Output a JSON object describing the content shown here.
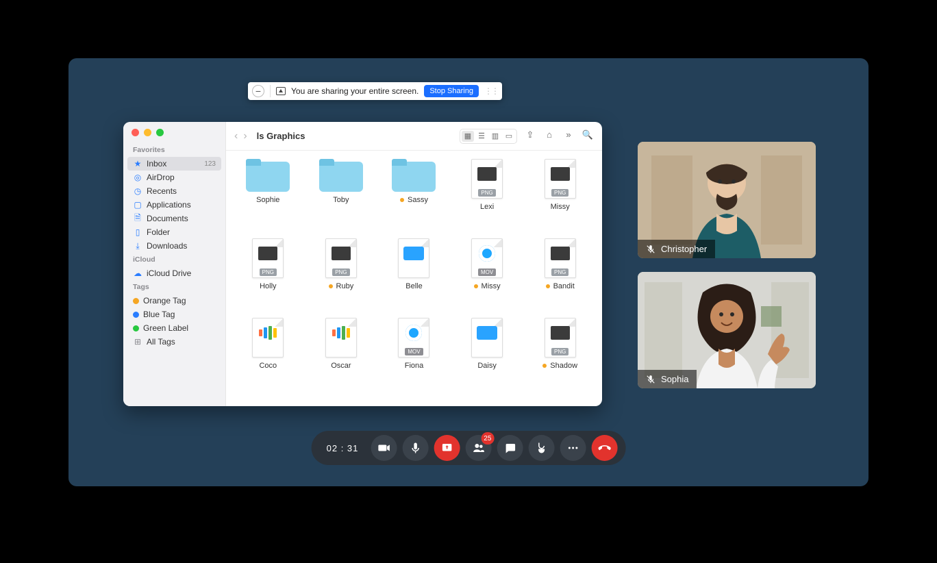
{
  "share_bar": {
    "message": "You are sharing your entire screen.",
    "stop_label": "Stop Sharing"
  },
  "finder": {
    "title": "ls Graphics",
    "sidebar": {
      "favorites_heading": "Favorites",
      "inbox": "Inbox",
      "inbox_count": "123",
      "airdrop": "AirDrop",
      "recents": "Recents",
      "applications": "Applications",
      "documents": "Documents",
      "folder": "Folder",
      "downloads": "Downloads",
      "icloud_heading": "iCloud",
      "icloud_drive": "iCloud Drive",
      "tags_heading": "Tags",
      "orange_tag": "Orange Tag",
      "blue_tag": "Blue Tag",
      "green_label": "Green Label",
      "all_tags": "All Tags"
    },
    "files": {
      "r1c1": "Sophie",
      "r1c2": "Toby",
      "r1c3": "Sassy",
      "r1c4": "Lexi",
      "r1c5": "Missy",
      "r2c1": "Holly",
      "r2c2": "Ruby",
      "r2c3": "Belle",
      "r2c4": "Missy",
      "r2c5": "Bandit",
      "r3c1": "Coco",
      "r3c2": "Oscar",
      "r3c3": "Fiona",
      "r3c4": "Daisy",
      "r3c5": "Shadow"
    },
    "badges": {
      "png": "PNG",
      "mov": "MOV"
    }
  },
  "participants": {
    "p1": "Christopher",
    "p2": "Sophia"
  },
  "call": {
    "timer": "02 : 31",
    "badge": "25"
  }
}
